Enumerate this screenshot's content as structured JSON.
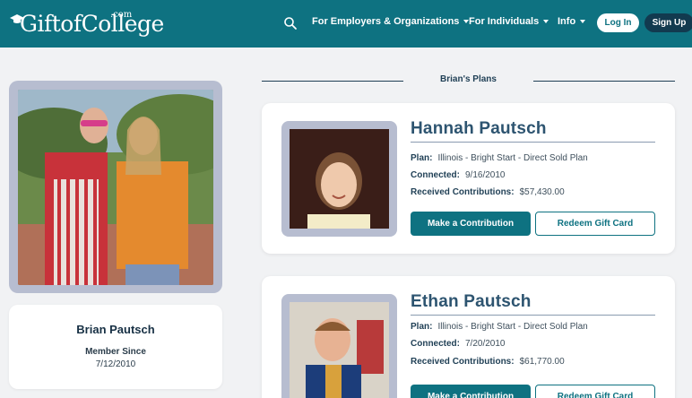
{
  "header": {
    "logo_text": "GiftofCollege",
    "logo_suffix": ".com",
    "nav": [
      {
        "label": "For Employers & Organizations"
      },
      {
        "label": "For Individuals"
      },
      {
        "label": "Info"
      }
    ],
    "login_label": "Log In",
    "signup_label": "Sign Up",
    "icons": {
      "search": "search-icon",
      "logo": "graduation-cap-icon",
      "dropdown": "caret-down-icon"
    }
  },
  "profile": {
    "name": "Brian Pautsch",
    "member_since_label": "Member Since",
    "member_since_date": "7/12/2010"
  },
  "plans_section": {
    "title": "Brian's Plans",
    "plan_label": "Plan:",
    "connected_label": "Connected:",
    "received_label": "Received Contributions:",
    "contribute_label": "Make a Contribution",
    "redeem_label": "Redeem Gift Card",
    "cards": [
      {
        "name": "Hannah Pautsch",
        "plan": "Illinois - Bright Start - Direct Sold Plan",
        "connected": "9/16/2010",
        "received": "$57,430.00"
      },
      {
        "name": "Ethan Pautsch",
        "plan": "Illinois - Bright Start - Direct Sold Plan",
        "connected": "7/20/2010",
        "received": "$61,770.00"
      }
    ]
  },
  "colors": {
    "brand_teal": "#0e7281",
    "navy": "#123a4f",
    "frame": "#b7bdd0",
    "background": "#f1f2f4"
  }
}
